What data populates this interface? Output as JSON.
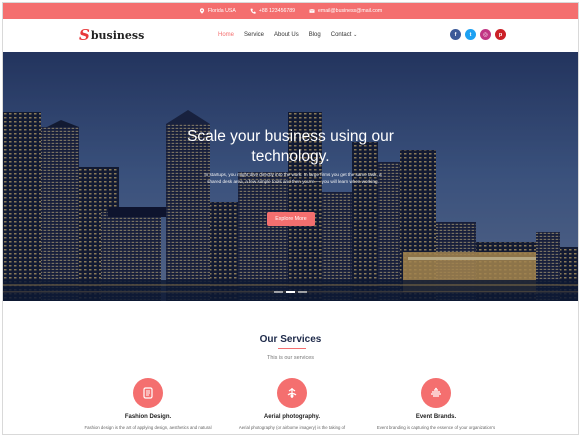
{
  "topbar": {
    "location": "Florida USA",
    "phone": "+88 123456789",
    "email": "email@business@mail.com"
  },
  "brand": {
    "logo_mark": "S",
    "logo_text": "business"
  },
  "nav": {
    "items": [
      {
        "label": "Home",
        "active": true
      },
      {
        "label": "Service",
        "active": false
      },
      {
        "label": "About Us",
        "active": false
      },
      {
        "label": "Blog",
        "active": false
      },
      {
        "label": "Contact",
        "active": false
      }
    ]
  },
  "socials": [
    {
      "name": "facebook-icon",
      "glyph": "f"
    },
    {
      "name": "twitter-icon",
      "glyph": "t"
    },
    {
      "name": "instagram-icon",
      "glyph": "◎"
    },
    {
      "name": "pinterest-icon",
      "glyph": "p"
    }
  ],
  "hero": {
    "title_line1": "Scale your business using our",
    "title_line2": "technology.",
    "subtitle": "In startups, you might dive directly into the work. In large firms you get the same task, a shared desk area, a few simple tools and then you're — you will learn when working.",
    "button_label": "Explore More",
    "slides": 3,
    "active_slide": 1
  },
  "services": {
    "title": "Our Services",
    "subtitle": "This is our services",
    "items": [
      {
        "name": "Fashion Design.",
        "desc": "Fashion design is the art of applying design, aesthetics and natural",
        "icon": "fashion-icon"
      },
      {
        "name": "Aerial photography.",
        "desc": "Aerial photography (or airborne imagery) is the taking of",
        "icon": "aerial-photo-icon"
      },
      {
        "name": "Event Brands.",
        "desc": "Event branding is capturing the essence of your organization's",
        "icon": "event-icon"
      }
    ]
  },
  "colors": {
    "accent": "#f46f6f",
    "logo_red": "#e8393b",
    "heading": "#1e2a4a"
  }
}
